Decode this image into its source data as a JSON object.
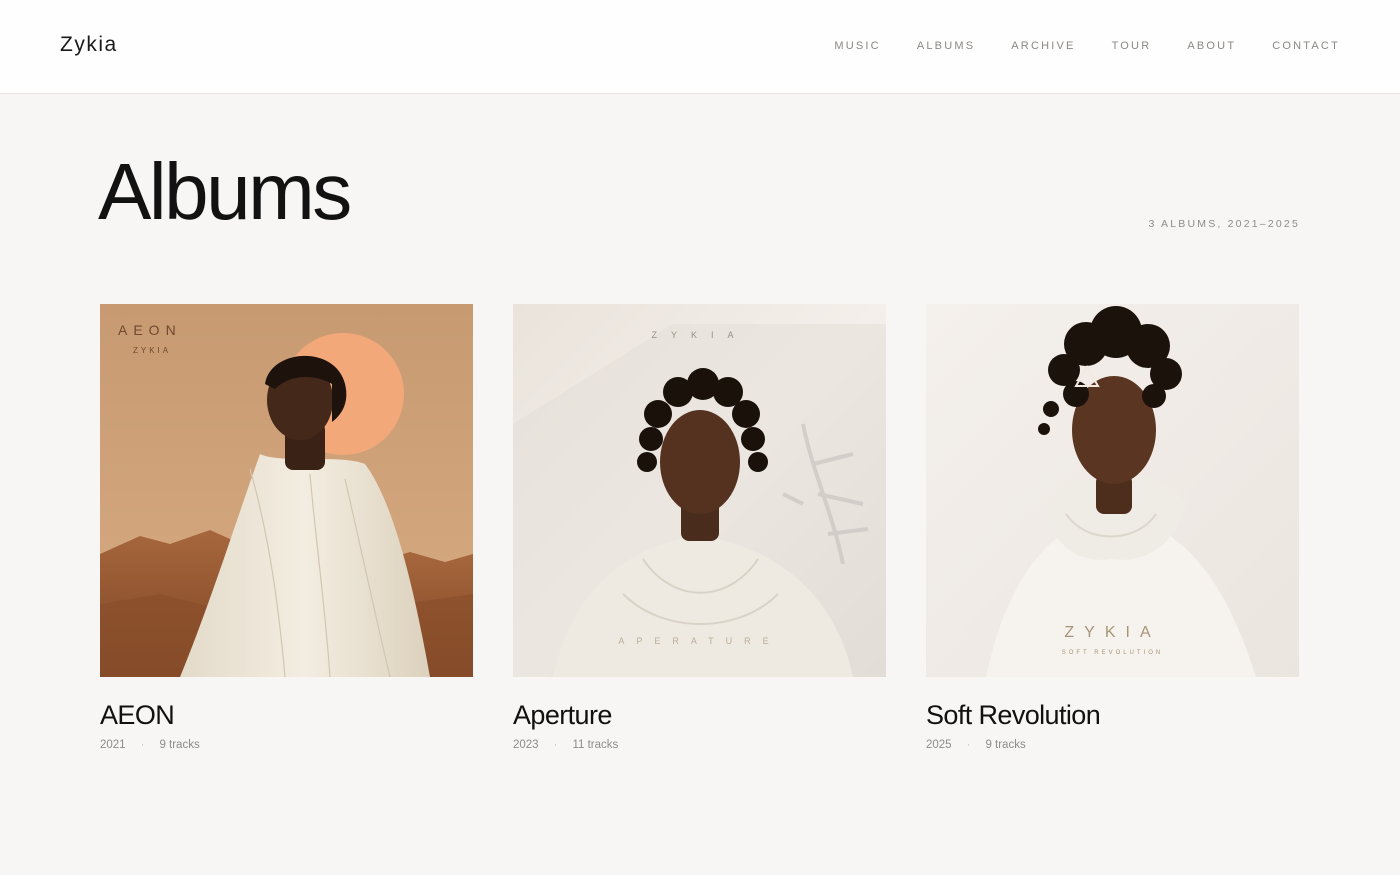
{
  "header": {
    "logo": "Zykia",
    "nav": [
      "MUSIC",
      "ALBUMS",
      "ARCHIVE",
      "TOUR",
      "ABOUT",
      "CONTACT"
    ]
  },
  "page": {
    "title": "Albums",
    "count_label": "3 ALBUMS, 2021–2025"
  },
  "albums": [
    {
      "title": "AEON",
      "year": "2021",
      "tracks": "9 tracks",
      "cover_line1": "AEON",
      "cover_line2": "ZYKIA"
    },
    {
      "title": "Aperture",
      "year": "2023",
      "tracks": "11 tracks",
      "cover_line1": "ZYKIA",
      "cover_line2": "APERATURE"
    },
    {
      "title": "Soft Revolution",
      "year": "2025",
      "tracks": "9 tracks",
      "cover_line1": "ZYKIA",
      "cover_line2": "SOFT REVOLUTION"
    }
  ],
  "meta_separator": "·",
  "colors": {
    "background": "#f7f6f4",
    "header_bg": "#fefefe",
    "text": "#151515",
    "muted": "#8e8c88",
    "aeon_sun": "#f2a878"
  },
  "icons": [
    "portrait-aeon",
    "portrait-aperture",
    "portrait-soft-revolution"
  ]
}
